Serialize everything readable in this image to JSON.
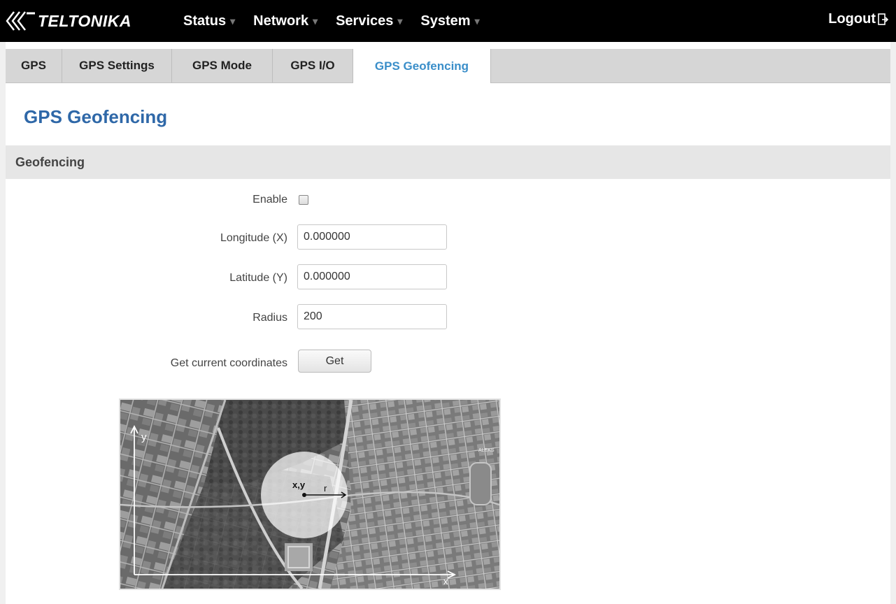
{
  "header": {
    "brand": "TELTONIKA",
    "menu": [
      {
        "label": "Status"
      },
      {
        "label": "Network"
      },
      {
        "label": "Services"
      },
      {
        "label": "System"
      }
    ],
    "logout_label": "Logout"
  },
  "tabs": [
    {
      "label": "GPS",
      "active": false
    },
    {
      "label": "GPS Settings",
      "active": false
    },
    {
      "label": "GPS Mode",
      "active": false
    },
    {
      "label": "GPS I/O",
      "active": false
    },
    {
      "label": "GPS Geofencing",
      "active": true
    }
  ],
  "page": {
    "title": "GPS Geofencing",
    "section_title": "Geofencing"
  },
  "form": {
    "enable": {
      "label": "Enable",
      "checked": false
    },
    "longitude": {
      "label": "Longitude (X)",
      "value": "0.000000"
    },
    "latitude": {
      "label": "Latitude (Y)",
      "value": "0.000000"
    },
    "radius": {
      "label": "Radius",
      "value": "200"
    },
    "get_coords": {
      "label": "Get current coordinates",
      "button_label": "Get"
    }
  },
  "map": {
    "y_label": "y",
    "x_label": "x",
    "center_label": "x,y",
    "radius_label": "r",
    "place_label": "ALEKS"
  },
  "colors": {
    "accent": "#3a8ec9",
    "title": "#2f68a8",
    "header_bg": "#000000"
  }
}
